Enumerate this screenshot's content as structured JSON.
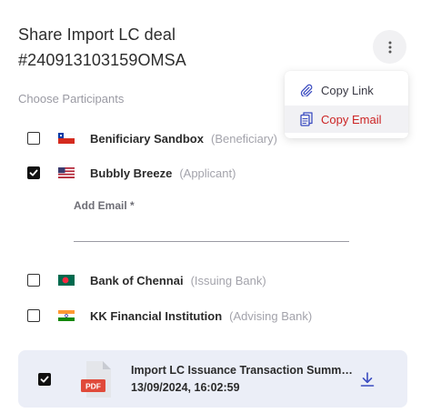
{
  "dialog": {
    "title_line1": "Share Import LC deal",
    "title_line2": "#240913103159OMSA",
    "choose_label": "Choose Participants"
  },
  "participants": [
    {
      "name": "Benificiary Sandbox",
      "role": "(Beneficiary)",
      "checked": false,
      "flag": "chile-flag-icon"
    },
    {
      "name": "Bubbly Breeze",
      "role": "(Applicant)",
      "checked": true,
      "flag": "usa-flag-icon"
    },
    {
      "name": "Bank of Chennai",
      "role": "(Issuing Bank)",
      "checked": false,
      "flag": "bangladesh-flag-icon"
    },
    {
      "name": "KK Financial Institution",
      "role": "(Advising Bank)",
      "checked": false,
      "flag": "india-flag-icon"
    }
  ],
  "email": {
    "label": "Add Email *",
    "value": ""
  },
  "attachment": {
    "checked": true,
    "name": "Import LC Issuance Transaction Summary",
    "timestamp": "13/09/2024, 16:02:59",
    "badge": "PDF"
  },
  "menu": {
    "copy_link": "Copy Link",
    "copy_email": "Copy Email"
  },
  "colors": {
    "accent_red": "#cc2424",
    "attachment_bg": "#ebeef7",
    "download_icon": "#3b4cc0"
  }
}
